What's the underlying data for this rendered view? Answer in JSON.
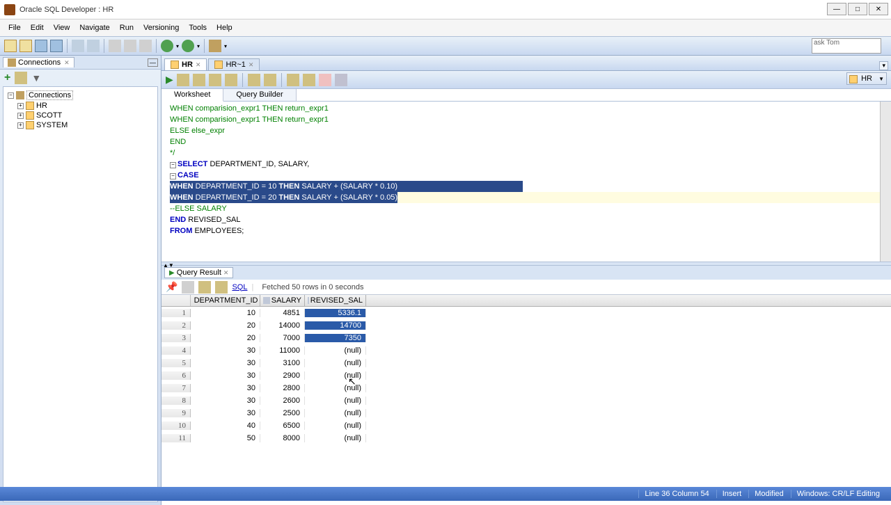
{
  "title": "Oracle SQL Developer : HR",
  "menu": [
    "File",
    "Edit",
    "View",
    "Navigate",
    "Run",
    "Versioning",
    "Tools",
    "Help"
  ],
  "search_hint": "ask\nTom",
  "connections_panel": {
    "tab": "Connections",
    "root": "Connections",
    "items": [
      "HR",
      "SCOTT",
      "SYSTEM"
    ]
  },
  "editor": {
    "tabs": [
      {
        "label": "HR",
        "icon": "db"
      },
      {
        "label": "HR~1",
        "icon": "db"
      }
    ],
    "ws_tabs": [
      "Worksheet",
      "Query Builder"
    ],
    "conn_dropdown": "HR",
    "code_lines": [
      {
        "text": "    WHEN comparision_expr1 THEN return_expr1",
        "cls": "comment"
      },
      {
        "text": "    WHEN comparision_expr1 THEN return_expr1",
        "cls": "comment"
      },
      {
        "text": "ELSE else_expr",
        "cls": "comment"
      },
      {
        "text": "END",
        "cls": "comment"
      },
      {
        "text": "*/",
        "cls": "comment"
      },
      {
        "text": " ",
        "cls": ""
      },
      {
        "text": "SELECT DEPARTMENT_ID, SALARY,",
        "cls": "sel",
        "fold": "minus"
      },
      {
        "text": "CASE",
        "cls": "kw",
        "fold": "minus"
      },
      {
        "text": "WHEN DEPARTMENT_ID = 10 THEN SALARY + (SALARY * 0.10)",
        "cls": "hl"
      },
      {
        "text": "WHEN DEPARTMENT_ID = 20 THEN SALARY + (SALARY * 0.05)",
        "cls": "hl-yellow"
      },
      {
        "text": "--ELSE SALARY",
        "cls": "comment"
      },
      {
        "text": "END REVISED_SAL",
        "cls": ""
      },
      {
        "text": "FROM EMPLOYEES;",
        "cls": ""
      }
    ]
  },
  "query_result": {
    "tab": "Query Result",
    "sql_label": "SQL",
    "status": "Fetched 50 rows in 0 seconds",
    "columns": [
      "DEPARTMENT_ID",
      "SALARY",
      "REVISED_SAL"
    ],
    "rows": [
      {
        "n": 1,
        "dept": "10",
        "sal": "4851",
        "rev": "5336.1",
        "sel": true
      },
      {
        "n": 2,
        "dept": "20",
        "sal": "14000",
        "rev": "14700",
        "sel": true
      },
      {
        "n": 3,
        "dept": "20",
        "sal": "7000",
        "rev": "7350",
        "sel": true
      },
      {
        "n": 4,
        "dept": "30",
        "sal": "11000",
        "rev": "(null)",
        "sel": false
      },
      {
        "n": 5,
        "dept": "30",
        "sal": "3100",
        "rev": "(null)",
        "sel": false
      },
      {
        "n": 6,
        "dept": "30",
        "sal": "2900",
        "rev": "(null)",
        "sel": false
      },
      {
        "n": 7,
        "dept": "30",
        "sal": "2800",
        "rev": "(null)",
        "sel": false
      },
      {
        "n": 8,
        "dept": "30",
        "sal": "2600",
        "rev": "(null)",
        "sel": false
      },
      {
        "n": 9,
        "dept": "30",
        "sal": "2500",
        "rev": "(null)",
        "sel": false
      },
      {
        "n": 10,
        "dept": "40",
        "sal": "6500",
        "rev": "(null)",
        "sel": false
      },
      {
        "n": 11,
        "dept": "50",
        "sal": "8000",
        "rev": "(null)",
        "sel": false
      }
    ]
  },
  "status_bar": {
    "pos": "Line 36 Column 54",
    "insert": "Insert",
    "modified": "Modified",
    "encoding": "Windows: CR/LF Editing"
  }
}
